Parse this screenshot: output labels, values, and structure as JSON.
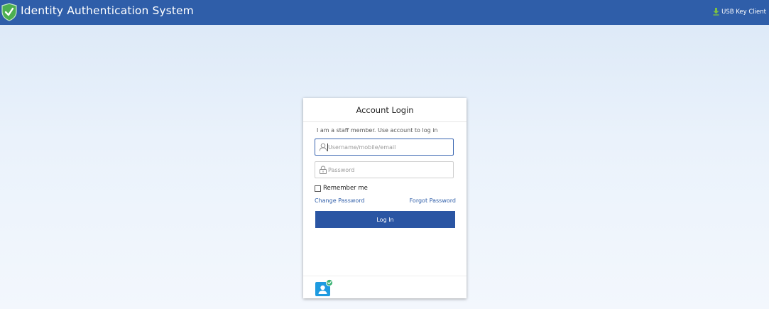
{
  "header": {
    "title": "Identity Authentication System",
    "usb_label": "USB Key Client",
    "logo_icon": "shield-check-icon",
    "usb_icon": "download-icon"
  },
  "login": {
    "title": "Account Login",
    "hint": "I am a staff member. Use account to log in",
    "username": {
      "placeholder": "Username/mobile/email",
      "value": "",
      "icon": "user-icon"
    },
    "password": {
      "placeholder": "Password",
      "value": "",
      "icon": "lock-icon"
    },
    "remember_label": "Remember me",
    "remember_checked": false,
    "change_password": "Change Password",
    "forgot_password": "Forgot Password",
    "submit_label": "Log In"
  },
  "footer": {
    "icon": "badge-user-verified-icon"
  },
  "colors": {
    "header_bg": "#2f5ea9",
    "accent": "#2a55a3",
    "logo_green": "#4caf50",
    "badge_blue": "#1e9be0",
    "badge_green": "#3bb273"
  }
}
